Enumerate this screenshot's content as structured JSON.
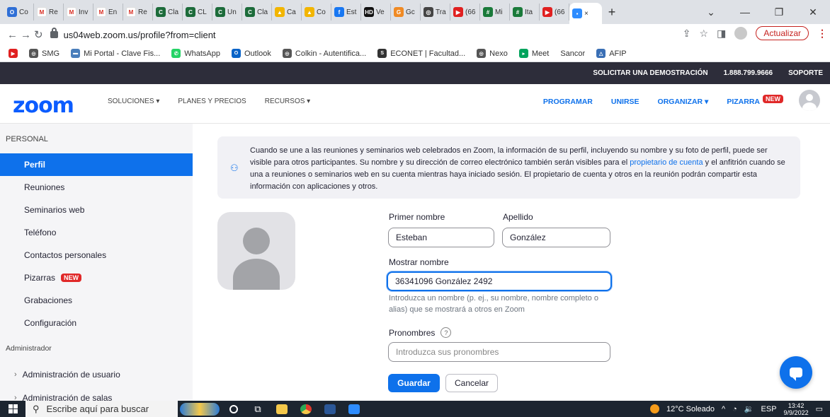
{
  "browser": {
    "tabs": [
      {
        "label": "Co",
        "color": "#2f6fd6",
        "glyph": "O"
      },
      {
        "label": "Re",
        "color": "#ffffff",
        "glyph": "M"
      },
      {
        "label": "Inv",
        "color": "#ffffff",
        "glyph": "M"
      },
      {
        "label": "En",
        "color": "#ffffff",
        "glyph": "M"
      },
      {
        "label": "Re",
        "color": "#ffffff",
        "glyph": "M"
      },
      {
        "label": "Cla",
        "color": "#1c6b3a",
        "glyph": "C"
      },
      {
        "label": "CL",
        "color": "#1c6b3a",
        "glyph": "C"
      },
      {
        "label": "Un",
        "color": "#1c6b3a",
        "glyph": "C"
      },
      {
        "label": "Cla",
        "color": "#1c6b3a",
        "glyph": "C"
      },
      {
        "label": "Ca",
        "color": "#f2b500",
        "glyph": "▲"
      },
      {
        "label": "Co",
        "color": "#f2b500",
        "glyph": "▲"
      },
      {
        "label": "Est",
        "color": "#1877f2",
        "glyph": "f"
      },
      {
        "label": "Ve",
        "color": "#111111",
        "glyph": "HD"
      },
      {
        "label": "Gc",
        "color": "#f08a24",
        "glyph": "G"
      },
      {
        "label": "Tra",
        "color": "#444444",
        "glyph": "◎"
      },
      {
        "label": "(66",
        "color": "#e02020",
        "glyph": "▶"
      },
      {
        "label": "Mi",
        "color": "#1a7a3a",
        "glyph": "#"
      },
      {
        "label": "Ita",
        "color": "#1a7a3a",
        "glyph": "#"
      },
      {
        "label": "(66",
        "color": "#e02020",
        "glyph": "▶"
      }
    ],
    "active_tab_close": "×",
    "new_tab": "+",
    "url": "us04web.zoom.us/profile?from=client",
    "update_label": "Actualizar",
    "bookmarks": [
      {
        "label": "",
        "color": "#e02020",
        "glyph": "▶"
      },
      {
        "label": "SMG",
        "color": "#555555",
        "glyph": "◎"
      },
      {
        "label": "Mi Portal - Clave Fis...",
        "color": "#4a7ebb",
        "glyph": "▬"
      },
      {
        "label": "WhatsApp",
        "color": "#25d366",
        "glyph": "✆"
      },
      {
        "label": "Outlook",
        "color": "#0a64c8",
        "glyph": "O"
      },
      {
        "label": "Colkin - Autentifica...",
        "color": "#555555",
        "glyph": "◎"
      },
      {
        "label": "ECONET | Facultad...",
        "color": "#333333",
        "glyph": "S"
      },
      {
        "label": "Nexo",
        "color": "#555555",
        "glyph": "◎"
      },
      {
        "label": "Meet",
        "color": "#00a35c",
        "glyph": "▸"
      },
      {
        "label": "Sancor",
        "color": "#ffffff",
        "glyph": ""
      },
      {
        "label": "AFIP",
        "color": "#3a6fb5",
        "glyph": "△"
      }
    ]
  },
  "topbar": {
    "demo": "SOLICITAR UNA DEMOSTRACIÓN",
    "phone": "1.888.799.9666",
    "support": "SOPORTE"
  },
  "nav": {
    "logo": "zoom",
    "left": [
      "SOLUCIONES ▾",
      "PLANES Y PRECIOS",
      "RECURSOS ▾"
    ],
    "right": {
      "schedule": "PROGRAMAR",
      "join": "UNIRSE",
      "host": "ORGANIZAR ▾",
      "whiteboard": "PIZARRA",
      "new_badge": "NEW"
    }
  },
  "sidebar": {
    "personal_header": "PERSONAL",
    "items": [
      {
        "label": "Perfil",
        "active": true
      },
      {
        "label": "Reuniones"
      },
      {
        "label": "Seminarios web"
      },
      {
        "label": "Teléfono"
      },
      {
        "label": "Contactos personales"
      },
      {
        "label": "Pizarras",
        "badge": "NEW"
      },
      {
        "label": "Grabaciones"
      },
      {
        "label": "Configuración"
      }
    ],
    "admin_header": "Administrador",
    "admin_items": [
      "Administración de usuario",
      "Administración de salas"
    ]
  },
  "info": {
    "text_before_link": "Cuando se une a las reuniones y seminarios web celebrados en Zoom, la información de su perfil, incluyendo su nombre y su foto de perfil, puede ser visible para otros participantes. Su nombre y su dirección de correo electrónico también serán visibles para el ",
    "link": "propietario de cuenta",
    "text_after_link": " y el anfitrión cuando se una a reuniones o seminarios web en su cuenta mientras haya iniciado sesión. El propietario de cuenta y otros en la reunión podrán compartir esta información con aplicaciones y otros."
  },
  "form": {
    "first_name_label": "Primer nombre",
    "first_name": "Esteban",
    "last_name_label": "Apellido",
    "last_name": "González",
    "display_name_label": "Mostrar nombre",
    "display_name": "36341096 González 2492",
    "display_help": "Introduzca un nombre (p. ej., su nombre, nombre completo o alias) que se mostrará a otros en Zoom",
    "pronouns_label": "Pronombres",
    "pronouns_help_icon": "?",
    "pronouns_placeholder": "Introduzca sus pronombres",
    "save": "Guardar",
    "cancel": "Cancelar"
  },
  "taskbar": {
    "search_placeholder": "Escribe aquí para buscar",
    "weather": "12°C Soleado",
    "lang": "ESP",
    "time": "13:42",
    "date": "9/9/2022"
  }
}
